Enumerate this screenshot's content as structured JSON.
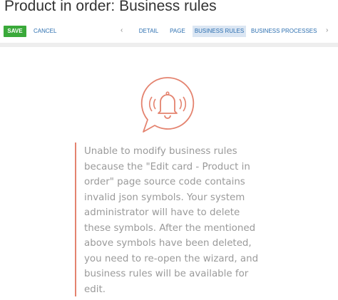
{
  "page": {
    "title": "Product in order: Business rules"
  },
  "toolbar": {
    "save_label": "SAVE",
    "cancel_label": "CANCEL"
  },
  "tabs": {
    "prev_arrow": "‹",
    "next_arrow": "›",
    "items": [
      {
        "label": "DETAIL",
        "active": false
      },
      {
        "label": "PAGE",
        "active": false
      },
      {
        "label": "BUSINESS RULES",
        "active": true
      },
      {
        "label": "BUSINESS PROCESSES",
        "active": false
      }
    ]
  },
  "message": {
    "icon": "bell-icon",
    "text": "Unable to modify business rules because the \"Edit card - Product in order\" page source code contains invalid json symbols. Your system administrator will have to delete these symbols. After the mentioned above symbols have been deleted, you need to re-open the wizard, and business rules will be available for edit."
  },
  "colors": {
    "accent": "#e4836f",
    "save_button": "#3aa93a",
    "link": "#2c6fb0",
    "active_tab_bg": "#dbe6f3"
  }
}
